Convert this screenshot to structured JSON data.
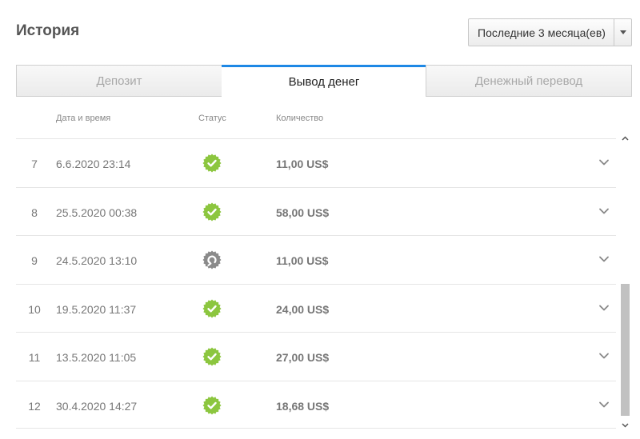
{
  "header": {
    "title": "История"
  },
  "period": {
    "selected": "Последние 3 месяца(ев)"
  },
  "tabs": [
    {
      "label": "Депозит",
      "active": false
    },
    {
      "label": "Вывод денег",
      "active": true
    },
    {
      "label": "Денежный перевод",
      "active": false
    }
  ],
  "columns": {
    "date": "Дата и время",
    "status": "Статус",
    "amount": "Количество"
  },
  "rows": [
    {
      "num": "7",
      "date": "6.6.2020 23:14",
      "status": "completed",
      "amount": "11,00 US$"
    },
    {
      "num": "8",
      "date": "25.5.2020 00:38",
      "status": "completed",
      "amount": "58,00 US$"
    },
    {
      "num": "9",
      "date": "24.5.2020 13:10",
      "status": "returned",
      "amount": "11,00 US$"
    },
    {
      "num": "10",
      "date": "19.5.2020 11:37",
      "status": "completed",
      "amount": "24,00 US$"
    },
    {
      "num": "11",
      "date": "13.5.2020 11:05",
      "status": "completed",
      "amount": "27,00 US$"
    },
    {
      "num": "12",
      "date": "30.4.2020 14:27",
      "status": "completed",
      "amount": "18,68 US$"
    }
  ],
  "icons": {
    "completed": "check-badge-icon",
    "returned": "return-badge-icon",
    "expand": "chevron-down-icon"
  },
  "colors": {
    "accent": "#1e88e5",
    "completed": "#8cc63f",
    "returned": "#8a8a8a"
  }
}
